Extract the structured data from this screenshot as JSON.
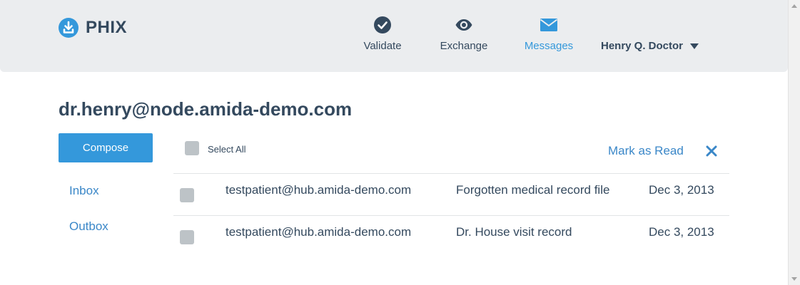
{
  "header": {
    "brand": "PHIX",
    "nav": [
      {
        "label": "Validate",
        "icon": "check-circle-icon"
      },
      {
        "label": "Exchange",
        "icon": "eye-icon"
      },
      {
        "label": "Messages",
        "icon": "envelope-icon",
        "active": true
      }
    ],
    "user": "Henry Q. Doctor"
  },
  "main": {
    "account": "dr.henry@node.amida-demo.com",
    "compose_label": "Compose",
    "folders": [
      "Inbox",
      "Outbox"
    ],
    "toolbar": {
      "select_all": "Select All",
      "mark_read": "Mark as Read"
    },
    "messages": [
      {
        "from": "testpatient@hub.amida-demo.com",
        "subject": "Forgotten medical record file",
        "date": "Dec 3, 2013"
      },
      {
        "from": "testpatient@hub.amida-demo.com",
        "subject": "Dr. House visit record",
        "date": "Dec 3, 2013"
      }
    ]
  },
  "colors": {
    "header_bg": "#ebedef",
    "text": "#34495e",
    "accent": "#3498db",
    "link": "#3a87c8",
    "checkbox": "#bdc3c7"
  }
}
